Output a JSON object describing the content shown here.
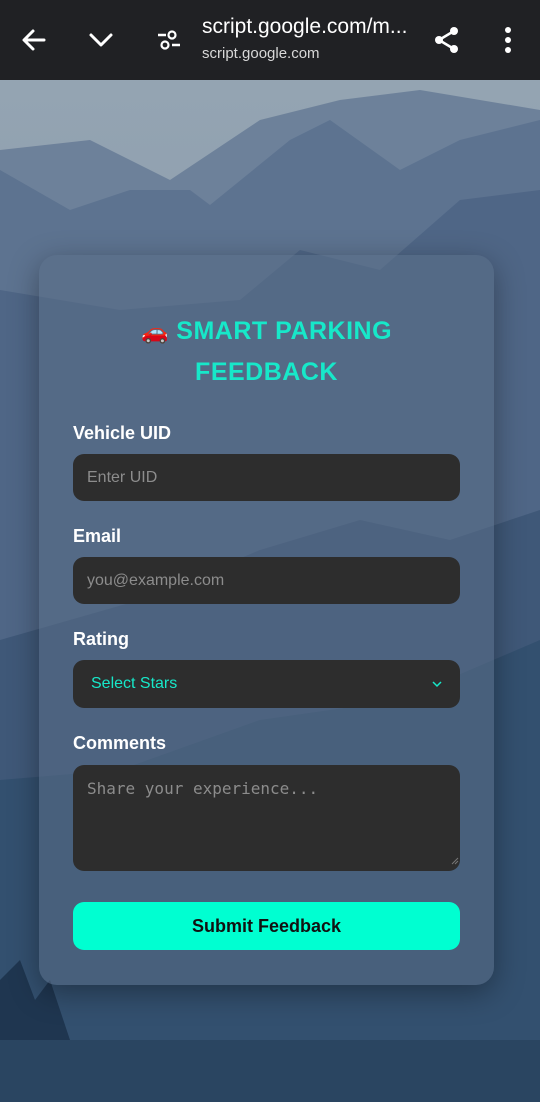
{
  "browser": {
    "url_main": "script.google.com/m...",
    "url_sub": "script.google.com",
    "icons": [
      "back-arrow-icon",
      "chevron-down-icon",
      "tune-icon",
      "share-icon",
      "more-vertical-icon"
    ]
  },
  "form": {
    "title_icon": "🚗",
    "title_line1": "SMART PARKING",
    "title_line2": "FEEDBACK",
    "uid_label": "Vehicle UID",
    "uid_placeholder": "Enter UID",
    "email_label": "Email",
    "email_placeholder": "you@example.com",
    "rating_label": "Rating",
    "rating_value": "Select Stars",
    "comments_label": "Comments",
    "comments_placeholder": "Share your experience...",
    "submit_label": "Submit Feedback"
  },
  "colors": {
    "accent": "#17e8c9",
    "button": "#00ffd1",
    "field_bg": "#2d2d2d",
    "topbar": "#202124"
  }
}
